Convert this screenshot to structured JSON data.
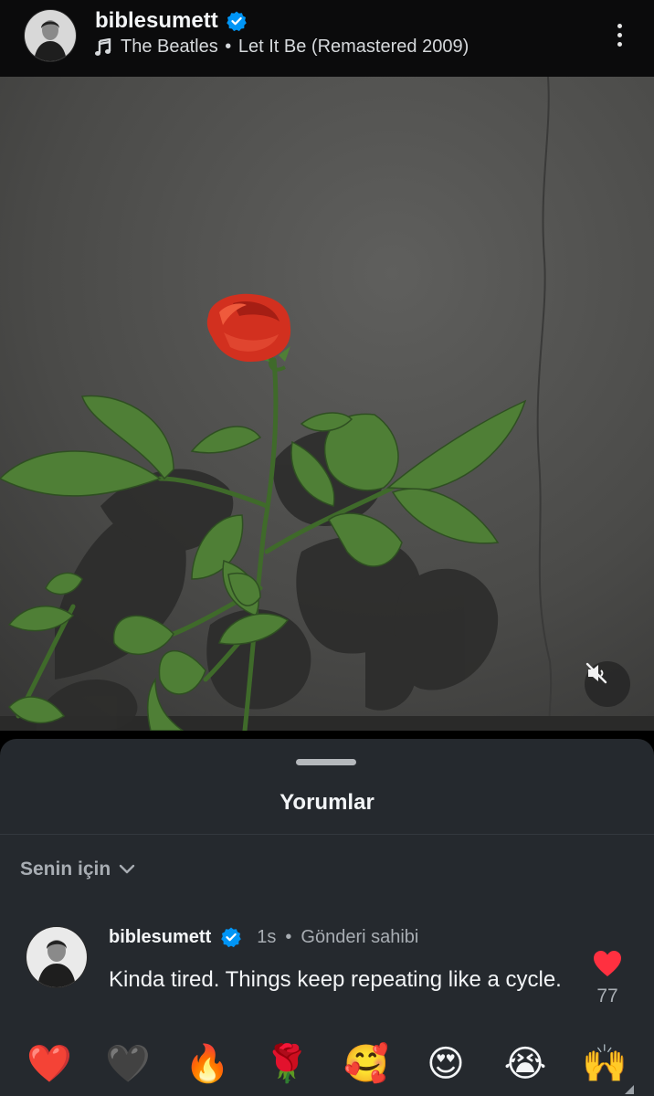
{
  "header": {
    "username": "biblesumett",
    "music_artist": "The Beatles",
    "music_separator": "•",
    "music_title": "Let It Be (Remastered 2009)"
  },
  "colors": {
    "verified_badge": "#0095f6",
    "like_heart": "#ff3040",
    "sheet_background": "#25292e"
  },
  "icons": {
    "music": "music-note-icon",
    "verified": "verified-badge-icon",
    "more": "more-vertical-icon",
    "mute": "speaker-muted-icon",
    "filter_chevron": "chevron-down-icon",
    "like": "heart-icon"
  },
  "comments_sheet": {
    "title": "Yorumlar",
    "filter_label": "Senin için"
  },
  "comment": {
    "username": "biblesumett",
    "time": "1s",
    "dot": "•",
    "owner_label": "Gönderi sahibi",
    "text": "Kinda tired. Things keep repeating like a cycle.",
    "like_count": "77"
  },
  "quick_reactions": [
    "❤️",
    "🖤",
    "🔥",
    "🌹",
    "🥰",
    "😍",
    "😭",
    "🙌"
  ]
}
